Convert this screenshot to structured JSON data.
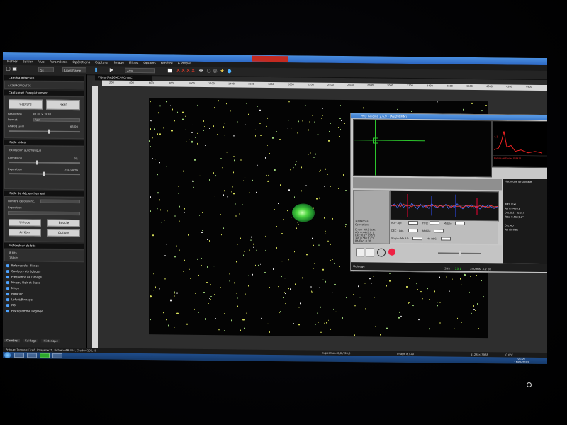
{
  "titlebar": {
    "title": ""
  },
  "menubar": {
    "items": [
      "Fichier",
      "Edition",
      "Vue",
      "Paramètres",
      "Opérations",
      "Capturer",
      "Image",
      "Filtres",
      "Options",
      "Fenêtre",
      "A Propos"
    ]
  },
  "toolbar": {
    "field1": "5s",
    "field2": "Light frame",
    "zoom": "40%"
  },
  "left_panel": {
    "camera_header": "Caméra détectée",
    "camera_name": "AA26MCPRO/TEC",
    "capture_header": "Capture et Enregistrement",
    "capture_btn": "Capture",
    "stop_btn": "Fixer",
    "resolution_label": "Résolution",
    "resolution_value": "6128 × 3938",
    "format_label": "Format",
    "format_value": "Raw",
    "analog_label": "Analog Gain",
    "analog_value": "65,00",
    "video_header": "Mode vidéo",
    "auto_expo": "Exposition automatique",
    "connexion_label": "Connexion",
    "connexion_value": "0%",
    "expo_label": "Exposition",
    "expo_value": "740.00ms",
    "mode_header": "Mode de déclenchement",
    "nbframes_label": "Nombre de déclenc.",
    "expo2_label": "Exposition",
    "unique_btn": "Unique",
    "boucle_btn": "Boucle",
    "arreter_btn": "Arrêter",
    "options_btn": "Options",
    "depth_header": "Profondeur de bits",
    "depth8": "8 bits",
    "depth16": "16 bits",
    "list_items": [
      "Balance des Blancs",
      "Couleurs et réglages",
      "Fréquence de l'image",
      "Niveau Noir et Blanc",
      "Miroir",
      "Rotation",
      "Lofset/Binnage",
      "ROI",
      "Histogramme Réglage"
    ],
    "bottom_tabs": [
      "Caméra",
      "Guidage",
      "Historique"
    ]
  },
  "canvas": {
    "tab_label": "Vidéo (AA26MCPRO/TEC)",
    "ruler_ticks": [
      "200",
      "400",
      "600",
      "800",
      "1000",
      "1200",
      "1400",
      "1600",
      "1800",
      "2000",
      "2200",
      "2400",
      "2600",
      "2800",
      "3000",
      "3200",
      "3400",
      "3600",
      "3800",
      "4000",
      "4200",
      "4400"
    ]
  },
  "phd": {
    "title": "PHD Guiding 2.6.9 - (ASI290MM)",
    "star_label": "Rampe de Etoiles PSF412",
    "star_val": "4.1",
    "stats_title": "Tendances",
    "check_tendances": "Tendances",
    "check_corrections": "Corrections",
    "rms_title": "Erreur RMS (px):",
    "rms_ra": "AD: 0.44 (0.8\")",
    "rms_dec": "Dec: 0.27 (0.5\")",
    "rms_tot": "Tot: 0.56 (1.2\")",
    "rms_pk": "RA Osc: 0.30",
    "ad_label": "AD - Agr.",
    "hyst_label": "Hyst",
    "mobile_label": "Mobile",
    "dec_label": "DEC - Agr.",
    "mobile2_label": "Mobile",
    "scope_label": "Scope: Mn AD",
    "scope2_label": "Mn DEC",
    "right_header": "Historique de guidage",
    "right_rms_title": "RMS (px)",
    "right_ad": "AD  0.44 (0.8\")",
    "right_dec": "Dec 0.27 (0.5\")",
    "right_total": "Total 0.56 (1.2\")",
    "right_osc": "Osc AD",
    "right_limits": "AD Limites",
    "status_left": "Guidage",
    "snr_label": "SNR",
    "snr_value": "25.1",
    "fps_value": "340 ms, 3.2 px"
  },
  "statusbar": {
    "left": "Prévue: Temps=13:46, Images=21, Fichier=AB,454, Gradu=106,40",
    "center": "Exposition: 0,0 / 30,0",
    "img": "Image 8 / 20",
    "res": "6128 × 3938",
    "temp": "-0,0°C"
  },
  "taskbar": {
    "time": "01:04",
    "date": "11/06/2023"
  },
  "colors": {
    "accent": "#3b7fd4",
    "star": "#d8e05a",
    "nebula": "#4cd640",
    "snr": "#30ff30"
  }
}
